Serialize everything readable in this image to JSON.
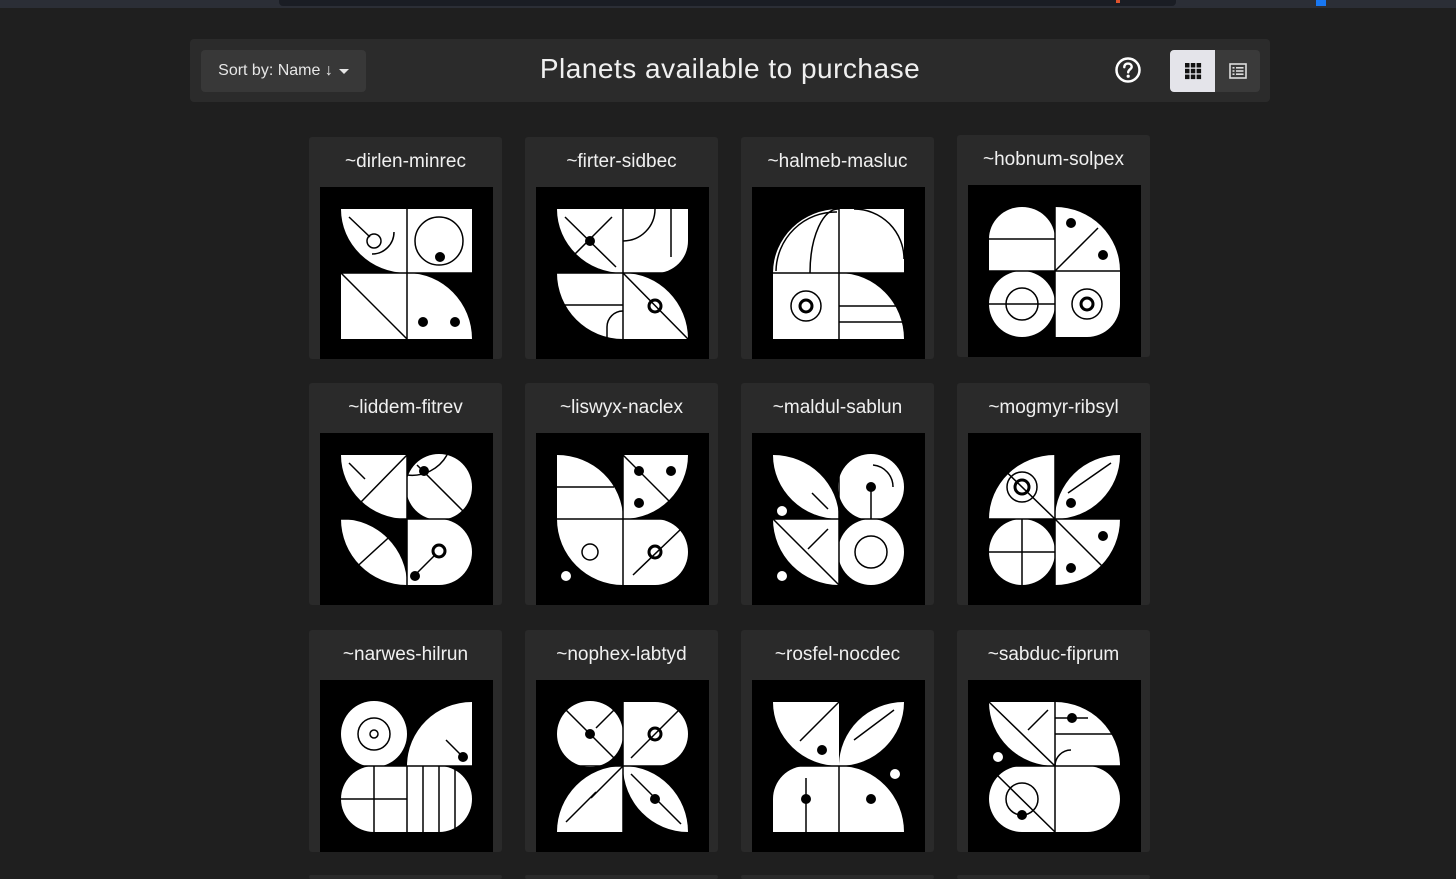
{
  "header": {
    "sort_label": "Sort by: Name ↓",
    "title": "Planets available to purchase",
    "help_icon": "question-circle-icon",
    "view_modes": [
      {
        "name": "grid",
        "icon": "grid-icon",
        "active": true
      },
      {
        "name": "list",
        "icon": "list-icon",
        "active": false
      }
    ]
  },
  "colors": {
    "background": "#1f1f1f",
    "card": "#2a2a2a",
    "header": "#2b2b2b",
    "sigil_bg": "#000000",
    "sigil_fg": "#ffffff"
  },
  "planets": [
    {
      "name": "~dirlen-minrec"
    },
    {
      "name": "~firter-sidbec"
    },
    {
      "name": "~halmeb-masluc"
    },
    {
      "name": "~hobnum-solpex"
    },
    {
      "name": "~liddem-fitrev"
    },
    {
      "name": "~liswyx-naclex"
    },
    {
      "name": "~maldul-sablun"
    },
    {
      "name": "~mogmyr-ribsyl"
    },
    {
      "name": "~narwes-hilrun"
    },
    {
      "name": "~nophex-labtyd"
    },
    {
      "name": "~rosfel-nocdec"
    },
    {
      "name": "~sabduc-fiprum"
    }
  ]
}
